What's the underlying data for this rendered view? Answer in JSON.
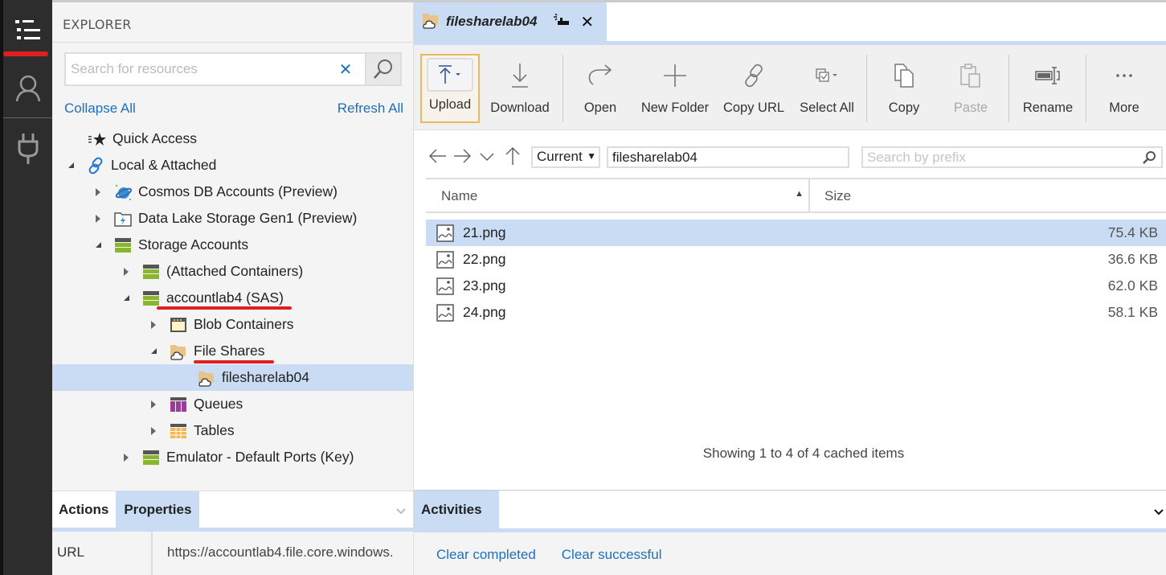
{
  "activity_bar": {
    "items": [
      {
        "name": "explorer",
        "icon": "list-icon",
        "active": true
      },
      {
        "name": "account",
        "icon": "person-icon"
      },
      {
        "name": "connect",
        "icon": "plug-icon"
      }
    ]
  },
  "explorer": {
    "title": "EXPLORER",
    "search_placeholder": "Search for resources",
    "collapse_all": "Collapse All",
    "refresh_all": "Refresh All",
    "tree": [
      {
        "label": "Quick Access",
        "icon": "quick-access-icon",
        "level": 0,
        "state": "none"
      },
      {
        "label": "Local & Attached",
        "icon": "link-icon",
        "level": 0,
        "state": "expanded"
      },
      {
        "label": "Cosmos DB Accounts (Preview)",
        "icon": "cosmos-db-icon",
        "level": 1,
        "state": "collapsed"
      },
      {
        "label": "Data Lake Storage Gen1 (Preview)",
        "icon": "data-lake-icon",
        "level": 1,
        "state": "collapsed"
      },
      {
        "label": "Storage Accounts",
        "icon": "storage-account-icon",
        "level": 1,
        "state": "expanded"
      },
      {
        "label": "(Attached Containers)",
        "icon": "storage-account-icon",
        "level": 2,
        "state": "collapsed"
      },
      {
        "label": "accountlab4 (SAS)",
        "icon": "storage-account-icon",
        "level": 2,
        "state": "expanded",
        "annotated": true
      },
      {
        "label": "Blob Containers",
        "icon": "blob-container-icon",
        "level": 3,
        "state": "collapsed"
      },
      {
        "label": "File Shares",
        "icon": "file-share-icon",
        "level": 3,
        "state": "expanded",
        "annotated": true
      },
      {
        "label": "filesharelab04",
        "icon": "file-share-icon",
        "level": 4,
        "state": "none",
        "selected": true
      },
      {
        "label": "Queues",
        "icon": "queue-icon",
        "level": 3,
        "state": "collapsed"
      },
      {
        "label": "Tables",
        "icon": "table-icon",
        "level": 3,
        "state": "collapsed"
      },
      {
        "label": "Emulator - Default Ports (Key)",
        "icon": "storage-account-icon",
        "level": 2,
        "state": "collapsed"
      }
    ]
  },
  "bottom_left": {
    "tabs": [
      {
        "label": "Actions",
        "active": false
      },
      {
        "label": "Properties",
        "active": true
      }
    ],
    "properties": [
      {
        "key": "URL",
        "value": "https://accountlab4.file.core.windows."
      }
    ]
  },
  "editor": {
    "tab": {
      "title": "filesharelab04",
      "icon": "file-share-icon"
    },
    "toolbar": [
      {
        "label": "Upload",
        "icon": "upload-icon",
        "highlighted": true,
        "dropdown": true
      },
      {
        "label": "Download",
        "icon": "download-icon"
      },
      {
        "label": "Open",
        "icon": "open-icon"
      },
      {
        "label": "New Folder",
        "icon": "plus-icon"
      },
      {
        "label": "Copy URL",
        "icon": "link-icon"
      },
      {
        "label": "Select All",
        "icon": "select-all-icon",
        "dropdown": true
      },
      {
        "label": "Copy",
        "icon": "copy-icon"
      },
      {
        "label": "Paste",
        "icon": "paste-icon",
        "disabled": true
      },
      {
        "label": "Rename",
        "icon": "rename-icon"
      },
      {
        "label": "More",
        "icon": "more-icon"
      }
    ],
    "nav": {
      "scope_selected": "Current",
      "path": "filesharelab04",
      "prefix_placeholder": "Search by prefix"
    },
    "columns": {
      "name": "Name",
      "size": "Size"
    },
    "files": [
      {
        "name": "21.png",
        "size": "75.4 KB",
        "selected": true
      },
      {
        "name": "22.png",
        "size": "36.6 KB"
      },
      {
        "name": "23.png",
        "size": "62.0 KB"
      },
      {
        "name": "24.png",
        "size": "58.1 KB"
      }
    ],
    "status": "Showing 1 to 4 of 4 cached items"
  },
  "activities": {
    "tab": "Activities",
    "links": [
      "Clear completed",
      "Clear successful"
    ]
  },
  "colors": {
    "selection": "#c9dcf3",
    "link": "#1e6fbf",
    "annotation": "#e0201f",
    "highlight_border": "#e8b960"
  }
}
